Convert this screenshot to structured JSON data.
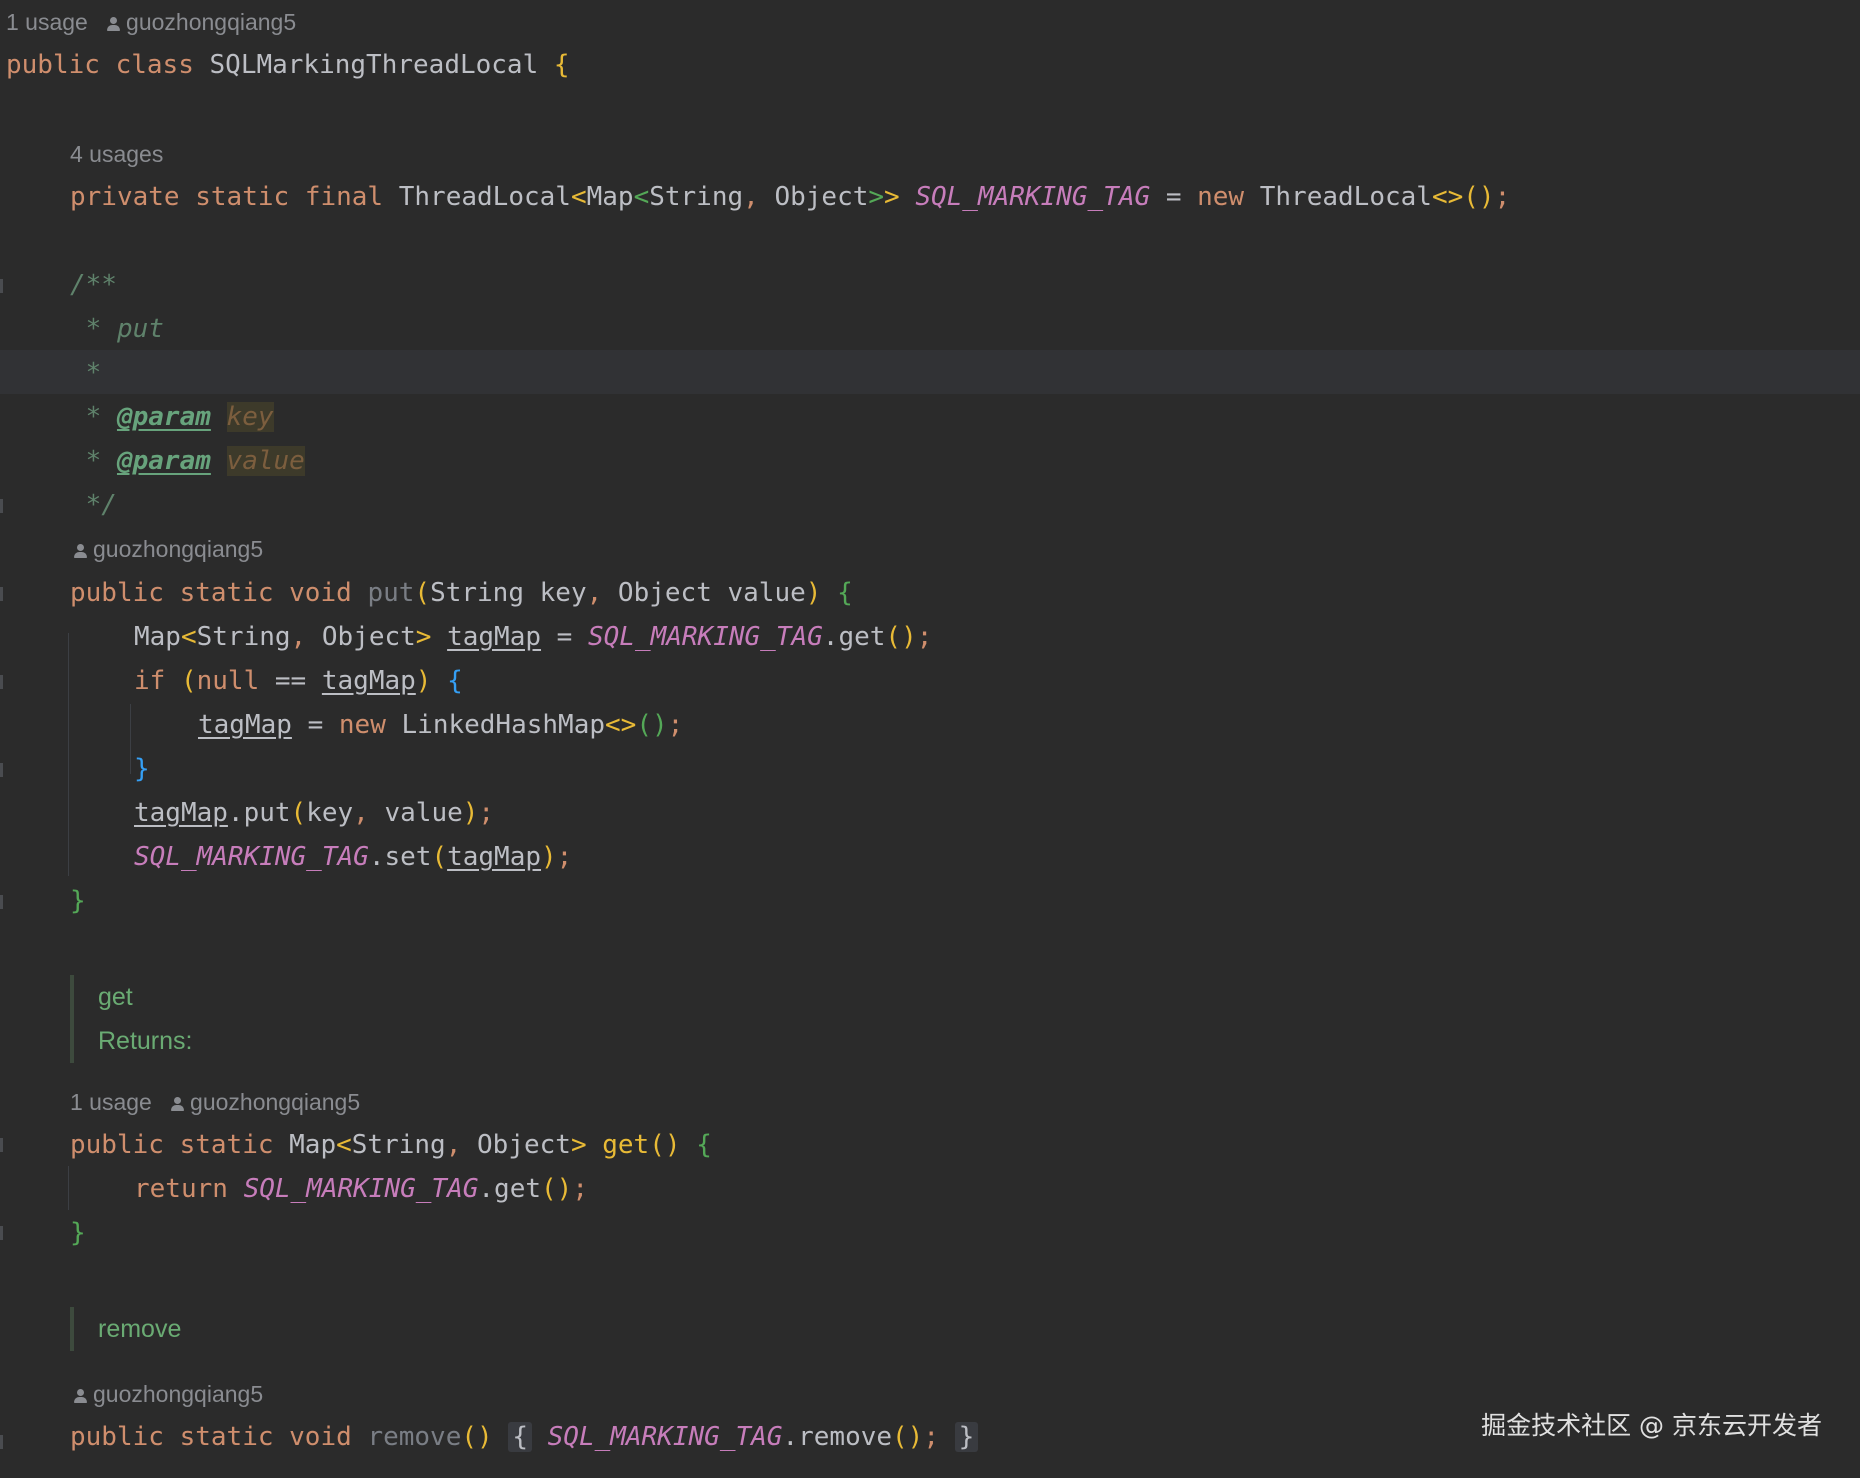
{
  "class_header": {
    "usages": "1 usage",
    "author": "guozhongqiang5",
    "keyword1": "public",
    "keyword2": "class",
    "name": "SQLMarkingThreadLocal"
  },
  "field_decl": {
    "usages": "4 usages",
    "k1": "private",
    "k2": "static",
    "k3": "final",
    "type_a": "ThreadLocal",
    "type_b": "Map",
    "type_c": "String",
    "type_d": "Object",
    "name": "SQL_MARKING_TAG",
    "kw_new": "new",
    "ctor": "ThreadLocal"
  },
  "javadoc_put": {
    "open": "/**",
    "line_put": " * put",
    "line_star": " *",
    "param_tag": "@param",
    "param_key": "key",
    "param_value": "value",
    "close": " */"
  },
  "put_method": {
    "author": "guozhongqiang5",
    "name": "put",
    "p1_type": "String",
    "p1_name": "key",
    "p2_type": "Object",
    "p2_name": "value",
    "local": "tagMap",
    "get_call": "get",
    "if_kw": "if",
    "null_kw": "null",
    "new_kw": "new",
    "lhm": "LinkedHashMap",
    "put_call": "put",
    "set_call": "set"
  },
  "get_doc": {
    "title": "get",
    "returns": "Returns:"
  },
  "get_method": {
    "usages": "1 usage",
    "author": "guozhongqiang5",
    "name": "get",
    "return_kw": "return"
  },
  "remove_doc": {
    "title": "remove"
  },
  "remove_method": {
    "author": "guozhongqiang5",
    "name": "remove"
  },
  "watermark": "掘金技术社区 @ 京东云开发者"
}
